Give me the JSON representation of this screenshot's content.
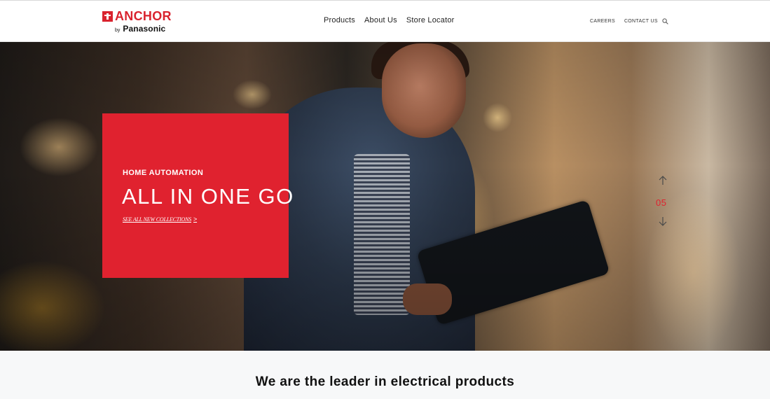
{
  "header": {
    "logo": {
      "brand": "ANCHOR",
      "by": "by",
      "parent": "Panasonic"
    },
    "nav": [
      {
        "label": "Products"
      },
      {
        "label": "About Us"
      },
      {
        "label": "Store Locator"
      }
    ],
    "utility": [
      {
        "label": "CAREERS"
      },
      {
        "label": "CONTACT US"
      }
    ],
    "search_icon": "search-icon"
  },
  "hero": {
    "kicker": "HOME AUTOMATION",
    "title": "ALL IN ONE GO",
    "link": "SEE ALL NEW COLLECTIONS",
    "link_chevron": ">",
    "slide_number": "05",
    "accent_color": "#e0222f"
  },
  "about": {
    "heading": "We are the leader in electrical products"
  }
}
